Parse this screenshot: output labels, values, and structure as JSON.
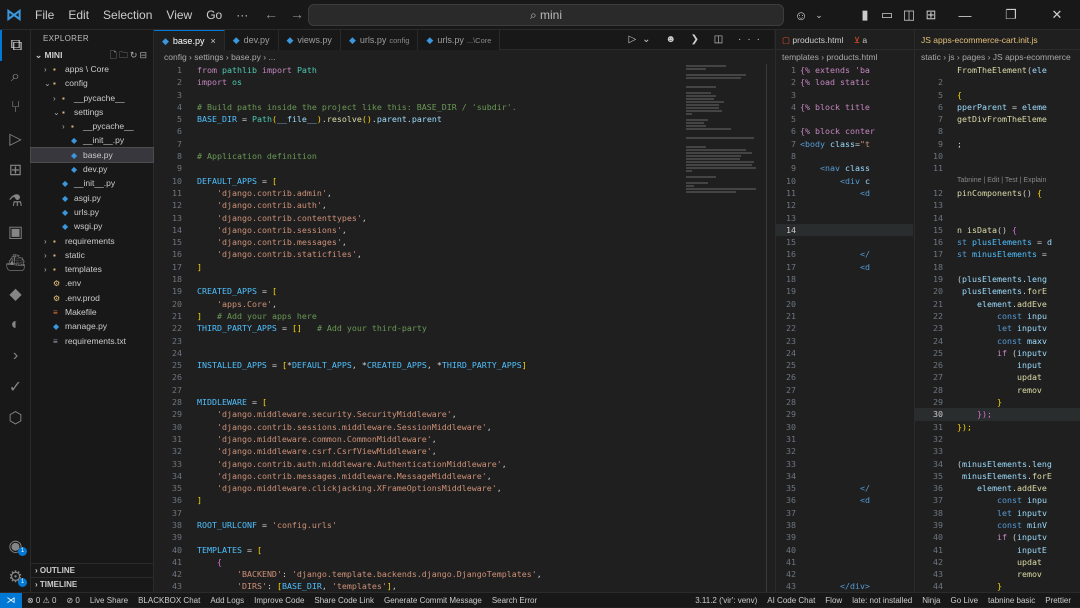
{
  "titlebar": {
    "menu": [
      "File",
      "Edit",
      "Selection",
      "View",
      "Go",
      "···"
    ],
    "search": "mini",
    "colors": {
      "accent": "#0078d4"
    }
  },
  "explorer": {
    "title": "EXPLORER",
    "root": "MINI",
    "items": [
      {
        "label": "apps \\ Core",
        "depth": 1,
        "chev": "›",
        "icon": "folder"
      },
      {
        "label": "config",
        "depth": 1,
        "chev": "⌄",
        "icon": "folder"
      },
      {
        "label": "__pycache__",
        "depth": 2,
        "chev": "›",
        "icon": "folder"
      },
      {
        "label": "settings",
        "depth": 2,
        "chev": "⌄",
        "icon": "folder"
      },
      {
        "label": "__pycache__",
        "depth": 3,
        "chev": "›",
        "icon": "folder"
      },
      {
        "label": "__init__.py",
        "depth": 3,
        "chev": "",
        "icon": "py"
      },
      {
        "label": "base.py",
        "depth": 3,
        "chev": "",
        "icon": "py",
        "selected": true
      },
      {
        "label": "dev.py",
        "depth": 3,
        "chev": "",
        "icon": "py"
      },
      {
        "label": "__init__.py",
        "depth": 2,
        "chev": "",
        "icon": "py"
      },
      {
        "label": "asgi.py",
        "depth": 2,
        "chev": "",
        "icon": "py"
      },
      {
        "label": "urls.py",
        "depth": 2,
        "chev": "",
        "icon": "py"
      },
      {
        "label": "wsgi.py",
        "depth": 2,
        "chev": "",
        "icon": "py"
      },
      {
        "label": "requirements",
        "depth": 1,
        "chev": "›",
        "icon": "folder"
      },
      {
        "label": "static",
        "depth": 1,
        "chev": "›",
        "icon": "folder"
      },
      {
        "label": "templates",
        "depth": 1,
        "chev": "›",
        "icon": "folder"
      },
      {
        "label": ".env",
        "depth": 1,
        "chev": "",
        "icon": "env"
      },
      {
        "label": ".env.prod",
        "depth": 1,
        "chev": "",
        "icon": "env"
      },
      {
        "label": "Makefile",
        "depth": 1,
        "chev": "",
        "icon": "make"
      },
      {
        "label": "manage.py",
        "depth": 1,
        "chev": "",
        "icon": "py"
      },
      {
        "label": "requirements.txt",
        "depth": 1,
        "chev": "",
        "icon": "txt"
      }
    ],
    "outline": "OUTLINE",
    "timeline": "TIMELINE"
  },
  "tabs": [
    {
      "label": "base.py",
      "desc": "",
      "active": true
    },
    {
      "label": "dev.py",
      "desc": ""
    },
    {
      "label": "views.py",
      "desc": ""
    },
    {
      "label": "urls.py",
      "desc": "config"
    },
    {
      "label": "urls.py",
      "desc": "...\\Core"
    }
  ],
  "breadcrumbs": "config › settings › base.py › ...",
  "editor2": {
    "tab": "products.html",
    "breadcrumb": "templates › products.html"
  },
  "editor3": {
    "tab": "JS  apps-ecommerce-cart.init.js",
    "breadcrumb": "static › js › pages › JS apps-ecommerce"
  },
  "statusbar": {
    "left": [
      "⊗ 0 ⚠ 0",
      "⊘ 0",
      "Live Share",
      "BLACKBOX Chat",
      "Add Logs",
      "Improve Code",
      "Share Code Link",
      "Generate Commit Message",
      "Search Error"
    ],
    "right": [
      "3.11.2 ('vir': venv)",
      "AI Code Chat",
      "Flow",
      "late: not installed",
      "Ninja",
      "Go Live",
      "tabnine basic",
      "Prettier"
    ]
  }
}
